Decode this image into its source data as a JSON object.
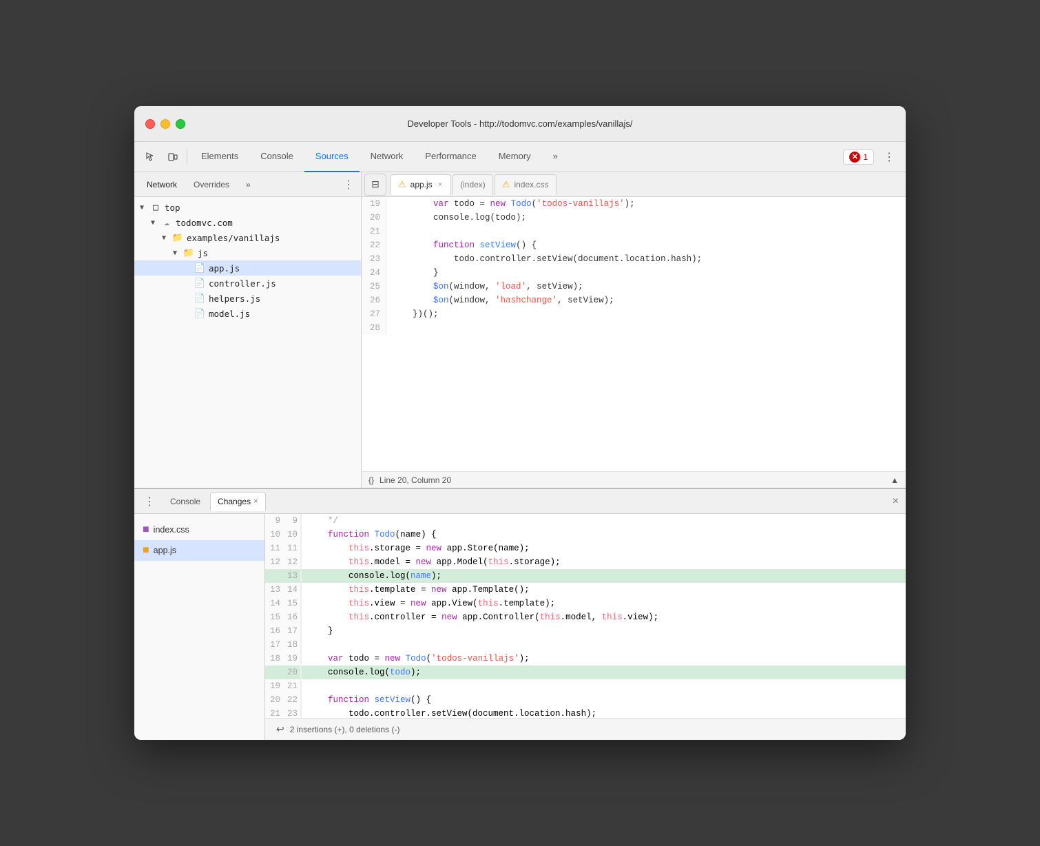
{
  "window": {
    "title": "Developer Tools - http://todomvc.com/examples/vanillajs/",
    "traffic_lights": [
      "red",
      "yellow",
      "green"
    ]
  },
  "main_toolbar": {
    "tabs": [
      {
        "label": "Elements",
        "active": false
      },
      {
        "label": "Console",
        "active": false
      },
      {
        "label": "Sources",
        "active": true
      },
      {
        "label": "Network",
        "active": false
      },
      {
        "label": "Performance",
        "active": false
      },
      {
        "label": "Memory",
        "active": false
      },
      {
        "label": "»",
        "active": false
      }
    ],
    "error_count": "1",
    "more_icon": "⋮"
  },
  "sidebar": {
    "tabs": [
      "Network",
      "Overrides",
      "»"
    ],
    "active_tab": "Network",
    "tree": [
      {
        "level": 1,
        "type": "folder-open",
        "label": "top",
        "arrow": "▼"
      },
      {
        "level": 2,
        "type": "cloud",
        "label": "todomvc.com",
        "arrow": "▼"
      },
      {
        "level": 3,
        "type": "folder-open",
        "label": "examples/vanillajs",
        "arrow": "▼"
      },
      {
        "level": 4,
        "type": "folder-open",
        "label": "js",
        "arrow": "▼"
      },
      {
        "level": 5,
        "type": "file-js",
        "label": "app.js"
      },
      {
        "level": 5,
        "type": "file-js",
        "label": "controller.js"
      },
      {
        "level": 5,
        "type": "file-js",
        "label": "helpers.js"
      },
      {
        "level": 5,
        "type": "file-js",
        "label": "model.js"
      }
    ]
  },
  "editor": {
    "tabs": [
      {
        "label": "app.js",
        "warn": true,
        "active": true,
        "closable": true
      },
      {
        "label": "(index)",
        "warn": false,
        "active": false,
        "closable": false
      },
      {
        "label": "index.css",
        "warn": true,
        "active": false,
        "closable": false
      }
    ],
    "lines": [
      {
        "num": "19",
        "tokens": [
          {
            "text": "        ",
            "class": ""
          },
          {
            "text": "var",
            "class": "kw"
          },
          {
            "text": " todo = ",
            "class": ""
          },
          {
            "text": "new",
            "class": "kw"
          },
          {
            "text": " ",
            "class": ""
          },
          {
            "text": "Todo",
            "class": "fn-name"
          },
          {
            "text": "(",
            "class": ""
          },
          {
            "text": "'todos-vanillajs'",
            "class": "str"
          },
          {
            "text": ");",
            "class": ""
          }
        ]
      },
      {
        "num": "20",
        "tokens": [
          {
            "text": "        console.log(todo);",
            "class": ""
          }
        ]
      },
      {
        "num": "21",
        "tokens": [
          {
            "text": "",
            "class": ""
          }
        ]
      },
      {
        "num": "22",
        "tokens": [
          {
            "text": "        ",
            "class": ""
          },
          {
            "text": "function",
            "class": "kw"
          },
          {
            "text": " ",
            "class": ""
          },
          {
            "text": "setView",
            "class": "fn-name"
          },
          {
            "text": "() {",
            "class": ""
          }
        ]
      },
      {
        "num": "23",
        "tokens": [
          {
            "text": "            todo.controller.setView(document.location.hash);",
            "class": ""
          }
        ]
      },
      {
        "num": "24",
        "tokens": [
          {
            "text": "        }",
            "class": ""
          }
        ]
      },
      {
        "num": "25",
        "tokens": [
          {
            "text": "        ",
            "class": ""
          },
          {
            "text": "$on",
            "class": "fn-name"
          },
          {
            "text": "(window, ",
            "class": ""
          },
          {
            "text": "'load'",
            "class": "str"
          },
          {
            "text": ", setView);",
            "class": ""
          }
        ]
      },
      {
        "num": "26",
        "tokens": [
          {
            "text": "        ",
            "class": ""
          },
          {
            "text": "$on",
            "class": "fn-name"
          },
          {
            "text": "(window, ",
            "class": ""
          },
          {
            "text": "'hashchange'",
            "class": "str"
          },
          {
            "text": ", setView);",
            "class": ""
          }
        ]
      },
      {
        "num": "27",
        "tokens": [
          {
            "text": "    })();",
            "class": ""
          }
        ]
      },
      {
        "num": "28",
        "tokens": [
          {
            "text": "",
            "class": ""
          }
        ]
      }
    ],
    "status": {
      "position": "Line 20, Column 20",
      "format_icon": "{}"
    }
  },
  "bottom_panel": {
    "tabs": [
      "Console",
      "Changes"
    ],
    "active_tab": "Changes",
    "files": [
      {
        "label": "index.css",
        "type": "css",
        "selected": false
      },
      {
        "label": "app.js",
        "type": "js",
        "selected": true
      }
    ],
    "diff_lines": [
      {
        "old": "9",
        "new": "9",
        "code": "     */",
        "added": false
      },
      {
        "old": "10",
        "new": "10",
        "code": "    function Todo(name) {",
        "added": false
      },
      {
        "old": "11",
        "new": "11",
        "code": "        this.storage = new app.Store(name);",
        "added": false
      },
      {
        "old": "12",
        "new": "12",
        "code": "        this.model = new app.Model(this.storage);",
        "added": false
      },
      {
        "old": "",
        "new": "13",
        "code": "        console.log(name);",
        "added": true
      },
      {
        "old": "13",
        "new": "14",
        "code": "        this.template = new app.Template();",
        "added": false
      },
      {
        "old": "14",
        "new": "15",
        "code": "        this.view = new app.View(this.template);",
        "added": false
      },
      {
        "old": "15",
        "new": "16",
        "code": "        this.controller = new app.Controller(this.model, this.view);",
        "added": false
      },
      {
        "old": "16",
        "new": "17",
        "code": "    }",
        "added": false
      },
      {
        "old": "17",
        "new": "18",
        "code": "",
        "added": false
      },
      {
        "old": "18",
        "new": "19",
        "code": "    var todo = new Todo('todos-vanillajs');",
        "added": false
      },
      {
        "old": "",
        "new": "20",
        "code": "    console.log(todo);",
        "added": true
      },
      {
        "old": "19",
        "new": "21",
        "code": "",
        "added": false
      },
      {
        "old": "20",
        "new": "22",
        "code": "    function setView() {",
        "added": false
      },
      {
        "old": "21",
        "new": "23",
        "code": "        todo.controller.setView(document.location.hash);",
        "added": false
      }
    ],
    "footer": "2 insertions (+), 0 deletions (-)"
  }
}
